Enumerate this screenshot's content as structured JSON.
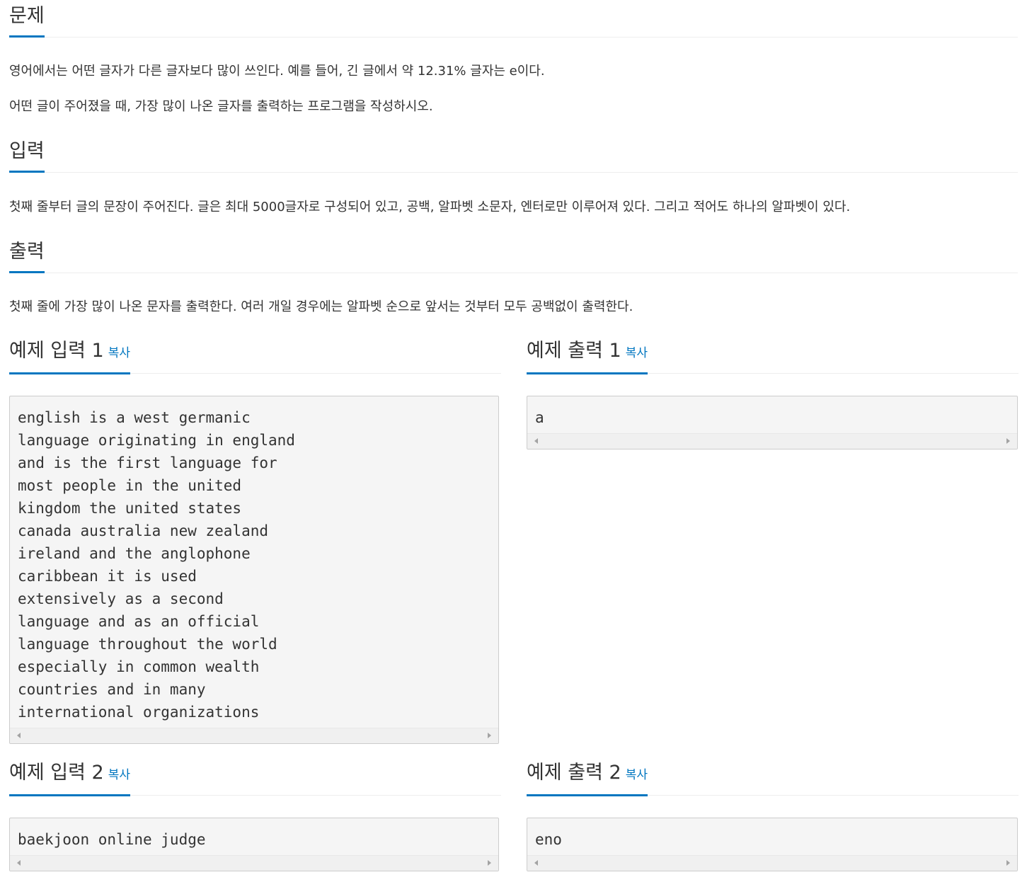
{
  "problem": {
    "heading": "문제",
    "paragraphs": [
      "영어에서는 어떤 글자가 다른 글자보다 많이 쓰인다. 예를 들어, 긴 글에서 약 12.31% 글자는 e이다.",
      "어떤 글이 주어졌을 때, 가장 많이 나온 글자를 출력하는 프로그램을 작성하시오."
    ]
  },
  "input": {
    "heading": "입력",
    "text": "첫째 줄부터 글의 문장이 주어진다. 글은 최대 5000글자로 구성되어 있고, 공백, 알파벳 소문자, 엔터로만 이루어져 있다. 그리고 적어도 하나의 알파벳이 있다."
  },
  "output": {
    "heading": "출력",
    "text": "첫째 줄에 가장 많이 나온 문자를 출력한다. 여러 개일 경우에는 알파벳 순으로 앞서는 것부터 모두 공백없이 출력한다."
  },
  "copy_label": "복사",
  "samples": {
    "input1_title": "예제 입력 1",
    "output1_title": "예제 출력 1",
    "input2_title": "예제 입력 2",
    "output2_title": "예제 출력 2",
    "input1": "english is a west germanic\nlanguage originating in england\nand is the first language for\nmost people in the united\nkingdom the united states\ncanada australia new zealand\nireland and the anglophone\ncaribbean it is used\nextensively as a second\nlanguage and as an official\nlanguage throughout the world\nespecially in common wealth\ncountries and in many\ninternational organizations",
    "output1": "a",
    "input2": "baekjoon online judge",
    "output2": "eno"
  }
}
